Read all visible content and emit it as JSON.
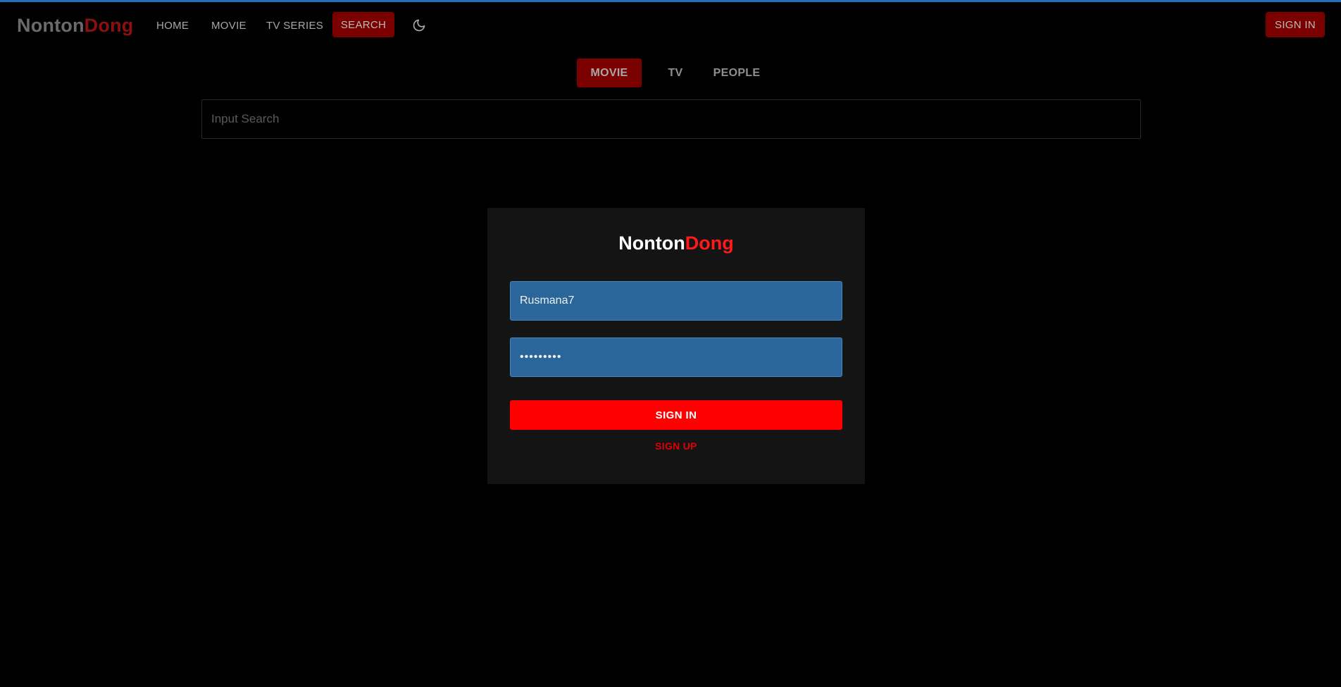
{
  "brand": {
    "name_part1": "Nonton",
    "name_part2": "Dong"
  },
  "colors": {
    "accent_red": "#ff0000",
    "dim_red": "#7a0000",
    "field_blue": "#2a6699",
    "top_accent_blue": "#1f6fbf",
    "background": "#000000",
    "card": "#141414"
  },
  "navbar": {
    "links": [
      {
        "label": "HOME"
      },
      {
        "label": "MOVIE"
      },
      {
        "label": "TV SERIES"
      }
    ],
    "search_label": "SEARCH",
    "theme_icon": "moon-icon",
    "signin_label": "SIGN IN"
  },
  "search": {
    "tabs": [
      {
        "label": "MOVIE",
        "active": true
      },
      {
        "label": "TV",
        "active": false
      },
      {
        "label": "PEOPLE",
        "active": false
      }
    ],
    "placeholder": "Input Search",
    "value": ""
  },
  "login": {
    "brand_part1": "Nonton",
    "brand_part2": "Dong",
    "username_value": "Rusmana7",
    "password_value": "•••••••••",
    "submit_label": "SIGN IN",
    "signup_label": "SIGN UP"
  }
}
